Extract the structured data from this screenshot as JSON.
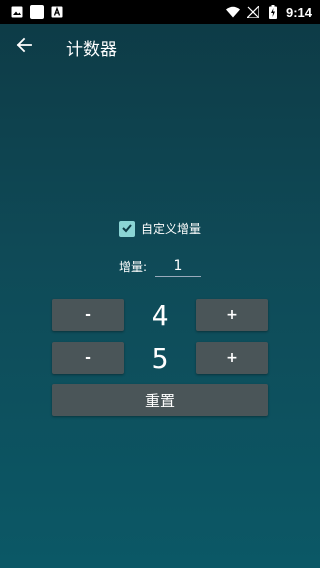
{
  "status_bar": {
    "time": "9:14",
    "left_icons": [
      "image-icon",
      "white-square-icon",
      "a-icon"
    ],
    "right_icons": [
      "wifi-icon",
      "no-signal-icon",
      "battery-charging-icon"
    ]
  },
  "app_bar": {
    "title": "计数器",
    "back_icon": "arrow-left-icon"
  },
  "custom_increment": {
    "checked": true,
    "label": "自定义增量"
  },
  "increment": {
    "label": "增量:",
    "value": "1"
  },
  "counters": [
    {
      "minus_label": "-",
      "value": "4",
      "plus_label": "+"
    },
    {
      "minus_label": "-",
      "value": "5",
      "plus_label": "+"
    }
  ],
  "reset_label": "重置",
  "colors": {
    "background_top": "#0d3a45",
    "background_bottom": "#0b5866",
    "button": "#4a5558",
    "checkbox": "#8ad4d4"
  }
}
